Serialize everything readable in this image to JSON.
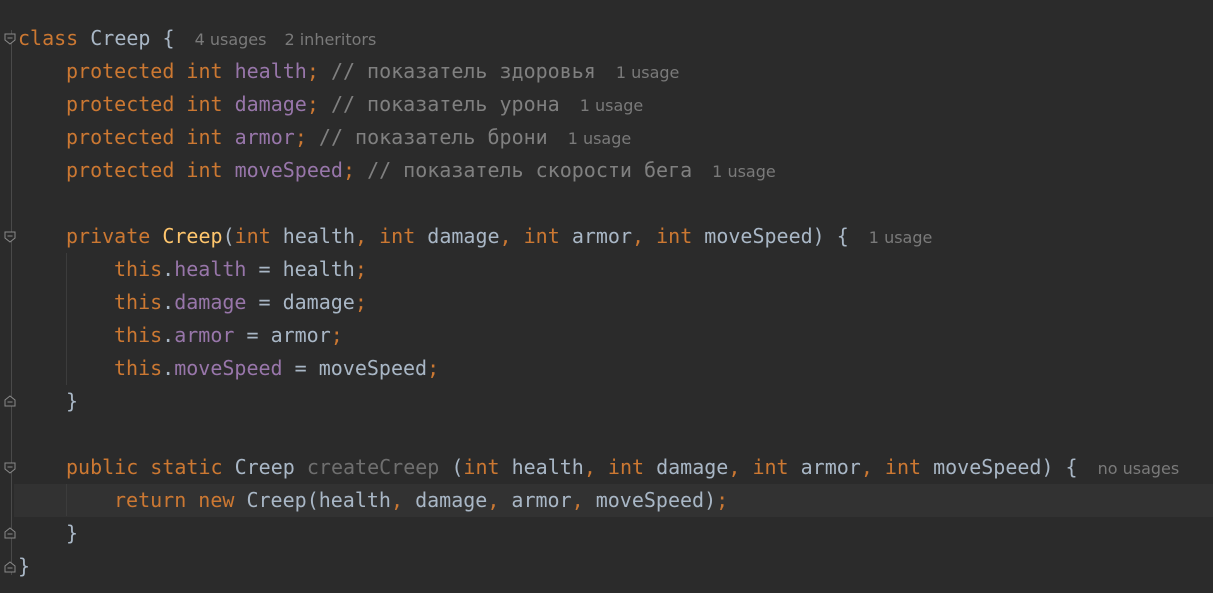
{
  "code": {
    "l1": {
      "kw": "class",
      "name": "Creep",
      "brace": "{",
      "hint_usages": "4 usages",
      "hint_inheritors": "2 inheritors"
    },
    "l2": {
      "mod": "protected",
      "type": "int",
      "field": "health",
      "semi": ";",
      "comment": "// показатель здоровья",
      "hint": "1 usage"
    },
    "l3": {
      "mod": "protected",
      "type": "int",
      "field": "damage",
      "semi": ";",
      "comment": "// показатель урона",
      "hint": "1 usage"
    },
    "l4": {
      "mod": "protected",
      "type": "int",
      "field": "armor",
      "semi": ";",
      "comment": "// показатель брони",
      "hint": "1 usage"
    },
    "l5": {
      "mod": "protected",
      "type": "int",
      "field": "moveSpeed",
      "semi": ";",
      "comment": "// показатель скорости бега",
      "hint": "1 usage"
    },
    "l7": {
      "mod": "private",
      "name": "Creep",
      "p1t": "int",
      "p1": "health",
      "p2t": "int",
      "p2": "damage",
      "p3t": "int",
      "p3": "armor",
      "p4t": "int",
      "p4": "moveSpeed",
      "tail": ") {",
      "hint": "1 usage"
    },
    "l8": {
      "this": "this",
      "field": "health",
      "rhs": "health"
    },
    "l9": {
      "this": "this",
      "field": "damage",
      "rhs": "damage"
    },
    "l10": {
      "this": "this",
      "field": "armor",
      "rhs": "armor"
    },
    "l11": {
      "this": "this",
      "field": "moveSpeed",
      "rhs": "moveSpeed"
    },
    "l12": {
      "brace": "}"
    },
    "l14": {
      "mod1": "public",
      "mod2": "static",
      "ret": "Creep",
      "name": "createCreep",
      "p1t": "int",
      "p1": "health",
      "p2t": "int",
      "p2": "damage",
      "p3t": "int",
      "p3": "armor",
      "p4t": "int",
      "p4": "moveSpeed",
      "tail": ") {",
      "hint": "no usages"
    },
    "l15": {
      "kw1": "return",
      "kw2": "new",
      "cls": "Creep",
      "args": "(health, damage, armor, moveSpeed)"
    },
    "l16": {
      "brace": "}"
    },
    "l17": {
      "brace": "}"
    }
  },
  "colors": {
    "background": "#2b2b2b",
    "keyword": "#cc7832",
    "field": "#9876aa",
    "comment": "#808080",
    "function": "#ffc66d",
    "text": "#a9b7c6"
  },
  "icons": [
    "fold-open-icon",
    "fold-close-icon"
  ]
}
